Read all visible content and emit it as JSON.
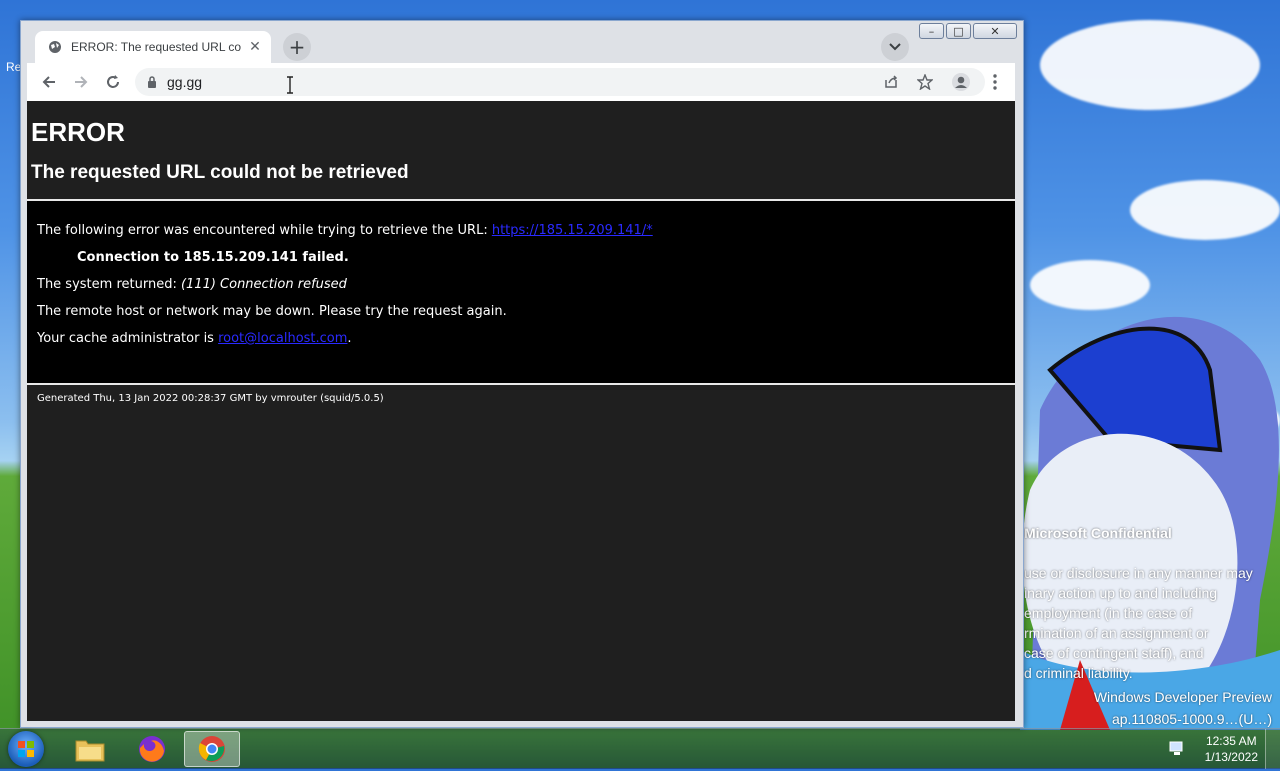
{
  "browser": {
    "tab_title": "ERROR: The requested URL could not be retrieved",
    "url": "gg.gg",
    "window_buttons": {
      "minimize": "–",
      "maximize": "□",
      "close": "✕"
    }
  },
  "page": {
    "heading": "ERROR",
    "subheading": "The requested URL could not be retrieved",
    "line1_prefix": "The following error was encountered while trying to retrieve the URL: ",
    "line1_link": "https://185.15.209.141/*",
    "line2": "Connection to 185.15.209.141 failed.",
    "line3_prefix": "The system returned: ",
    "line3_em": "(111) Connection refused",
    "line4": "The remote host or network may be down. Please try the request again.",
    "line5_prefix": "Your cache administrator is ",
    "line5_link": "root@localhost.com",
    "line5_suffix": ".",
    "footer": "Generated Thu, 13 Jan 2022 00:28:37 GMT by vmrouter (squid/5.0.5)"
  },
  "desktop": {
    "watermark_title": "Microsoft Confidential",
    "watermark_body": "use or disclosure in any manner may\ninary action up to and including\nemployment (in the case of\nrmination of an assignment or\ncase of contingent staff), and\nd criminal liability.",
    "dev_preview_line1": "Windows Developer Preview",
    "dev_preview_line2": "ap.110805-1000.9…(U…)",
    "left_fragment": "Re"
  },
  "taskbar": {
    "time": "12:35 AM",
    "date": "1/13/2022",
    "apps": [
      "file-explorer",
      "firefox",
      "chrome"
    ]
  }
}
